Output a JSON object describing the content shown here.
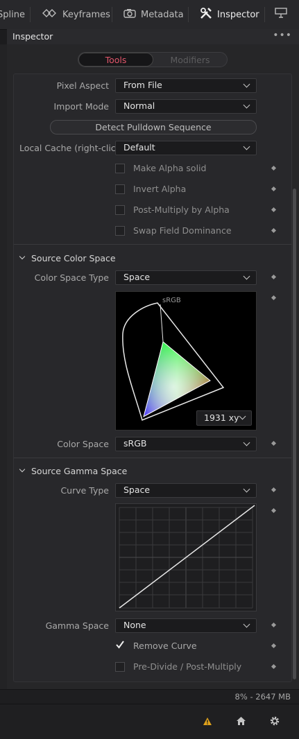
{
  "tabs": [
    {
      "label": "Spline",
      "icon": "spline-icon"
    },
    {
      "label": "Keyframes",
      "icon": "keyframes-icon"
    },
    {
      "label": "Metadata",
      "icon": "metadata-icon"
    },
    {
      "label": "Inspector",
      "icon": "inspector-icon"
    }
  ],
  "panel": {
    "title": "Inspector",
    "more": "•••"
  },
  "segment": {
    "tools": "Tools",
    "modifiers": "Modifiers"
  },
  "fields": {
    "pixel_aspect": {
      "label": "Pixel Aspect",
      "value": "From File"
    },
    "import_mode": {
      "label": "Import Mode",
      "value": "Normal"
    },
    "detect_button": "Detect Pulldown Sequence",
    "local_cache": {
      "label": "Local Cache (right-clic...",
      "value": "Default"
    }
  },
  "checkboxes": [
    {
      "label": "Make Alpha solid",
      "checked": false
    },
    {
      "label": "Invert Alpha",
      "checked": false
    },
    {
      "label": "Post-Multiply by Alpha",
      "checked": false
    },
    {
      "label": "Swap Field Dominance",
      "checked": false
    }
  ],
  "color_section": {
    "title": "Source Color Space",
    "type_label": "Color Space Type",
    "type_value": "Space",
    "chart_label": "sRGB",
    "chart_mode": "1931 xy",
    "space_label": "Color Space",
    "space_value": "sRGB"
  },
  "gamma_section": {
    "title": "Source Gamma Space",
    "curve_label": "Curve Type",
    "curve_value": "Space",
    "gamma_label": "Gamma Space",
    "gamma_value": "None",
    "remove_curve": "Remove Curve",
    "predivide": "Pre-Divide / Post-Multiply"
  },
  "status": {
    "memory": "8% - 2647 MB"
  },
  "colors": {
    "accent": "#e2566b",
    "warning": "#e0a21b"
  }
}
